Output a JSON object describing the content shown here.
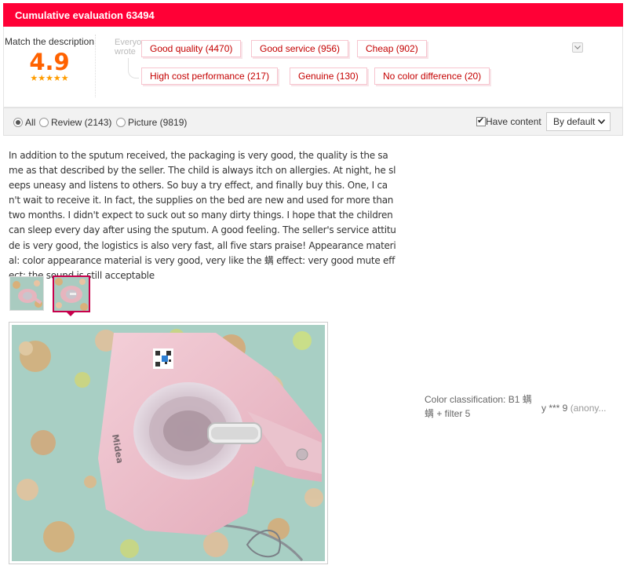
{
  "header": {
    "title": "Cumulative evaluation 63494"
  },
  "summary": {
    "match_label": "Match the description",
    "score": "4.9",
    "stars": "★★★★★",
    "hint": "Everyone wrote",
    "tags": [
      "Good quality (4470)",
      "Good service (956)",
      "Cheap (902)",
      "High cost performance (217)",
      "Genuine (130)",
      "No color difference (20)"
    ]
  },
  "filters": {
    "all": "All",
    "review": "Review (2143)",
    "picture": "Picture (9819)",
    "selected": "All",
    "have_content": "Have content",
    "have_content_checked": true,
    "sort": "By default"
  },
  "review": {
    "text": "In addition to the sputum received, the packaging is very good, the quality is the same as that described by the seller. The child is always itch on allergies. At night, he sleeps uneasy and listens to others. So buy a try effect, and finally buy this. One, I can't wait to receive it. In fact, the supplies on the bed are new and used for more than two months. I didn't expect to suck out so many dirty things. I hope that the children can sleep every day after using the sputum. A good feeling. The seller's service attitude is very good, the logistics is also very fast, all five stars praise! Appearance material: color appearance material is very good, very like the 螨 effect: very good mute effect: the sound is still acceptable",
    "sku": "Color classification: B1 螨螨 + filter 5",
    "user": "y *** 9",
    "anon": "(anony..."
  },
  "photo": {
    "brand": "Midea"
  },
  "colors": {
    "header": "#ff0036",
    "score": "#ff6200",
    "tag_text": "#c40000",
    "thumb_border": "#c7004c"
  }
}
